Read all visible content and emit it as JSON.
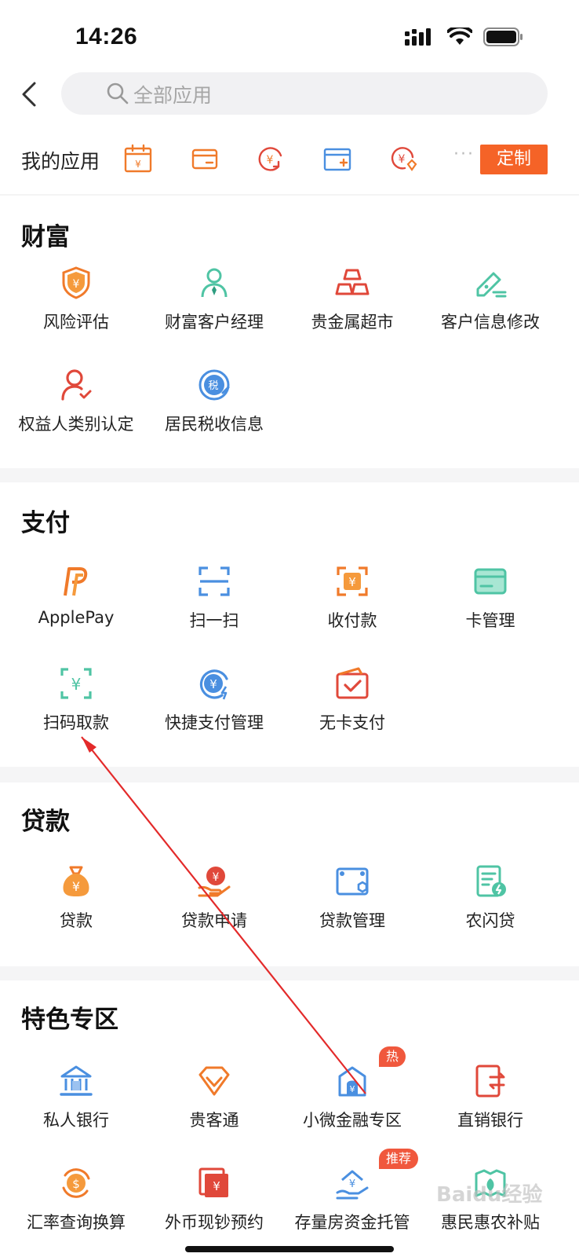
{
  "status": {
    "time": "14:26"
  },
  "search": {
    "placeholder": "全部应用"
  },
  "my_apps": {
    "label": "我的应用",
    "more": "···",
    "customize_label": "定制"
  },
  "colors": {
    "accent": "#f56327",
    "orange": "#f07a2a",
    "teal": "#4fc4a4",
    "blue": "#4a8fe0",
    "red": "#e0483a",
    "badge": "#f0583d"
  },
  "sections": {
    "wealth": {
      "title": "财富",
      "items": [
        {
          "label": "风险评估",
          "icon": "shield-yen-icon"
        },
        {
          "label": "财富客户经理",
          "icon": "manager-icon"
        },
        {
          "label": "贵金属超市",
          "icon": "gold-bars-icon"
        },
        {
          "label": "客户信息修改",
          "icon": "edit-card-icon"
        },
        {
          "label": "权益人类别认定",
          "icon": "person-check-icon"
        },
        {
          "label": "居民税收信息",
          "icon": "tax-icon"
        }
      ]
    },
    "payment": {
      "title": "支付",
      "items": [
        {
          "label": "ApplePay",
          "icon": "applepay-icon"
        },
        {
          "label": "扫一扫",
          "icon": "scan-icon"
        },
        {
          "label": "收付款",
          "icon": "receive-pay-icon"
        },
        {
          "label": "卡管理",
          "icon": "card-icon"
        },
        {
          "label": "扫码取款",
          "icon": "scan-yen-icon"
        },
        {
          "label": "快捷支付管理",
          "icon": "quick-pay-icon"
        },
        {
          "label": "无卡支付",
          "icon": "cardless-pay-icon"
        }
      ]
    },
    "loan": {
      "title": "贷款",
      "items": [
        {
          "label": "贷款",
          "icon": "money-bag-icon"
        },
        {
          "label": "贷款申请",
          "icon": "loan-apply-icon"
        },
        {
          "label": "贷款管理",
          "icon": "loan-manage-icon"
        },
        {
          "label": "农闪贷",
          "icon": "farm-loan-icon"
        }
      ]
    },
    "featured": {
      "title": "特色专区",
      "items": [
        {
          "label": "私人银行",
          "icon": "bank-icon"
        },
        {
          "label": "贵客通",
          "icon": "diamond-icon"
        },
        {
          "label": "小微金融专区",
          "icon": "micro-finance-icon",
          "badge": "热"
        },
        {
          "label": "直销银行",
          "icon": "direct-bank-icon"
        },
        {
          "label": "汇率查询换算",
          "icon": "exchange-rate-icon"
        },
        {
          "label": "外币现钞预约",
          "icon": "forex-cash-icon"
        },
        {
          "label": "存量房资金托管",
          "icon": "house-escrow-icon",
          "badge": "推荐"
        },
        {
          "label": "惠民惠农补贴",
          "icon": "subsidy-icon"
        }
      ]
    }
  },
  "watermark": "Baidu经验"
}
